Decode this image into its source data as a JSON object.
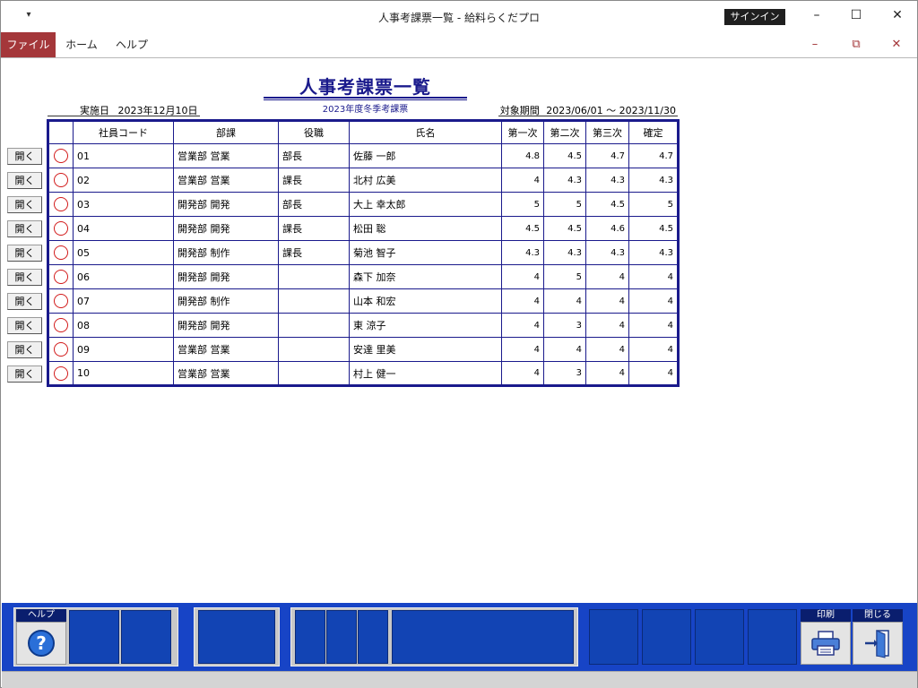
{
  "window": {
    "title": "人事考課票一覧  -  給料らくだプロ",
    "signin_label": "サインイン",
    "qat_icon": "customize-quick-access-icon"
  },
  "ribbon": {
    "tabs": [
      "ファイル",
      "ホーム",
      "ヘルプ"
    ]
  },
  "report": {
    "title": "人事考課票一覧",
    "subtitle": "2023年度冬季考課票",
    "exec_date_label": "実施日",
    "exec_date": "2023年12月10日",
    "period_label": "対象期間",
    "period": "2023/06/01 ～ 2023/11/30"
  },
  "table": {
    "headers": [
      "社員コード",
      "部課",
      "役職",
      "氏名",
      "第一次",
      "第二次",
      "第三次",
      "確定"
    ],
    "open_label": "開く",
    "rows": [
      {
        "code": "01",
        "dept": "営業部 営業",
        "role": "部長",
        "name": "佐藤 一郎",
        "s1": "4.8",
        "s2": "4.5",
        "s3": "4.7",
        "final": "4.7"
      },
      {
        "code": "02",
        "dept": "営業部 営業",
        "role": "課長",
        "name": "北村 広美",
        "s1": "4",
        "s2": "4.3",
        "s3": "4.3",
        "final": "4.3"
      },
      {
        "code": "03",
        "dept": "開発部 開発",
        "role": "部長",
        "name": "大上 幸太郎",
        "s1": "5",
        "s2": "5",
        "s3": "4.5",
        "final": "5"
      },
      {
        "code": "04",
        "dept": "開発部 開発",
        "role": "課長",
        "name": "松田 聡",
        "s1": "4.5",
        "s2": "4.5",
        "s3": "4.6",
        "final": "4.5"
      },
      {
        "code": "05",
        "dept": "開発部 制作",
        "role": "課長",
        "name": "菊池 智子",
        "s1": "4.3",
        "s2": "4.3",
        "s3": "4.3",
        "final": "4.3"
      },
      {
        "code": "06",
        "dept": "開発部 開発",
        "role": "",
        "name": "森下 加奈",
        "s1": "4",
        "s2": "5",
        "s3": "4",
        "final": "4"
      },
      {
        "code": "07",
        "dept": "開発部 制作",
        "role": "",
        "name": "山本 和宏",
        "s1": "4",
        "s2": "4",
        "s3": "4",
        "final": "4"
      },
      {
        "code": "08",
        "dept": "開発部 開発",
        "role": "",
        "name": "東 涼子",
        "s1": "4",
        "s2": "3",
        "s3": "4",
        "final": "4"
      },
      {
        "code": "09",
        "dept": "営業部 営業",
        "role": "",
        "name": "安達 里美",
        "s1": "4",
        "s2": "4",
        "s3": "4",
        "final": "4"
      },
      {
        "code": "10",
        "dept": "営業部 営業",
        "role": "",
        "name": "村上 健一",
        "s1": "4",
        "s2": "3",
        "s3": "4",
        "final": "4"
      }
    ]
  },
  "footer": {
    "help_label": "ヘルプ",
    "help_icon": "question-mark-icon",
    "print_label": "印刷",
    "print_icon": "printer-icon",
    "close_label": "閉じる",
    "close_icon": "exit-door-icon"
  }
}
